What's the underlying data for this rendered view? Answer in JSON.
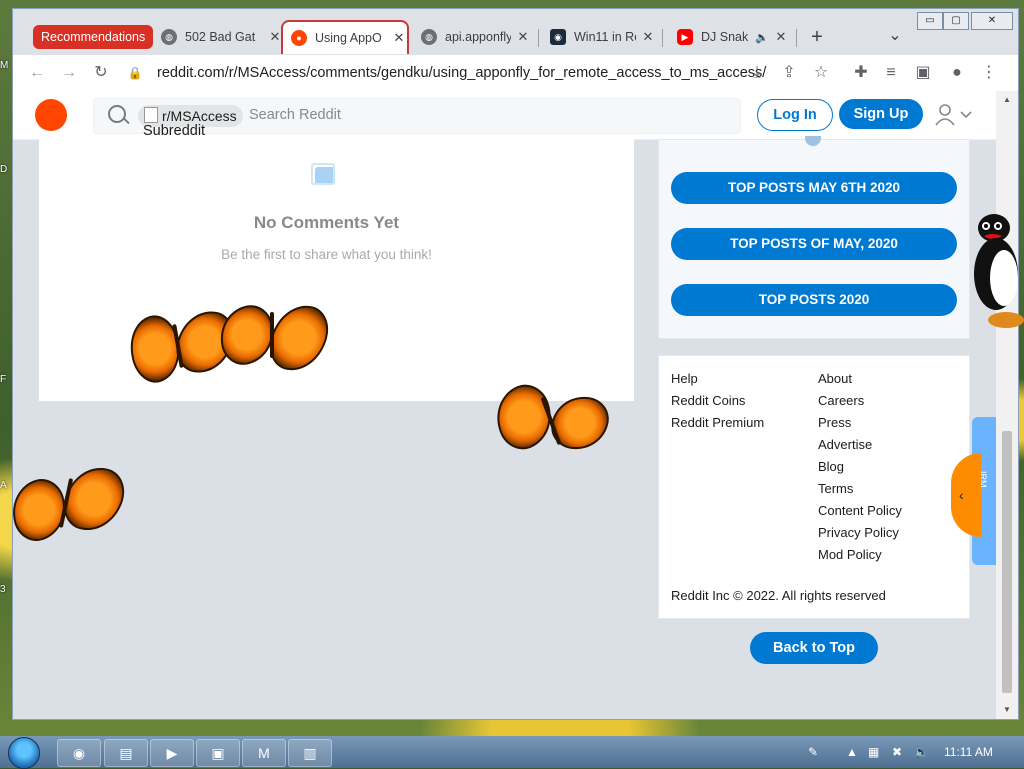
{
  "window": {
    "controls": {
      "minimize": "▭",
      "maximize": "▢",
      "close": "✕"
    }
  },
  "tabs": [
    {
      "label": "502 Bad Gat",
      "favicon": "globe-icon"
    },
    {
      "label": "Using AppO",
      "favicon": "reddit-icon",
      "active": true
    },
    {
      "label": "api.apponfly",
      "favicon": "globe-icon"
    },
    {
      "label": "Win11 in Re",
      "favicon": "win11-icon"
    },
    {
      "label": "DJ Snak",
      "favicon": "youtube-icon"
    }
  ],
  "recommendations_chip": "Recommendations",
  "toolbar": {
    "url": "reddit.com/r/MSAccess/comments/gendku/using_apponfly_for_remote_access_to_ms_access/"
  },
  "reddit": {
    "subreddit_chip": "r/MSAccess",
    "subreddit_icon_alt": "Subreddit Icon",
    "search_placeholder": "Search Reddit",
    "login": "Log In",
    "signup": "Sign Up",
    "no_comments": "No Comments Yet",
    "no_comments_sub": "Be the first to share what you think!",
    "top_posts": [
      "TOP POSTS MAY 6TH 2020",
      "TOP POSTS OF MAY, 2020",
      "TOP POSTS 2020"
    ],
    "footer_left": [
      "Help",
      "Reddit Coins",
      "Reddit Premium"
    ],
    "footer_right": [
      "About",
      "Careers",
      "Press",
      "Advertise",
      "Blog",
      "Terms",
      "Content Policy",
      "Privacy Policy",
      "Mod Policy"
    ],
    "copyright": "Reddit Inc © 2022. All rights reserved",
    "back_to_top": "Back to Top"
  },
  "side_widget_label": "IRM",
  "desktop_glyphs": [
    "M",
    "D",
    "F",
    "A",
    "3"
  ],
  "taskbar": {
    "clock": "11:11 AM"
  },
  "colors": {
    "reddit_blue": "#0079d3",
    "reddit_orange": "#ff4500",
    "tab_active_border": "#c53a3a"
  }
}
